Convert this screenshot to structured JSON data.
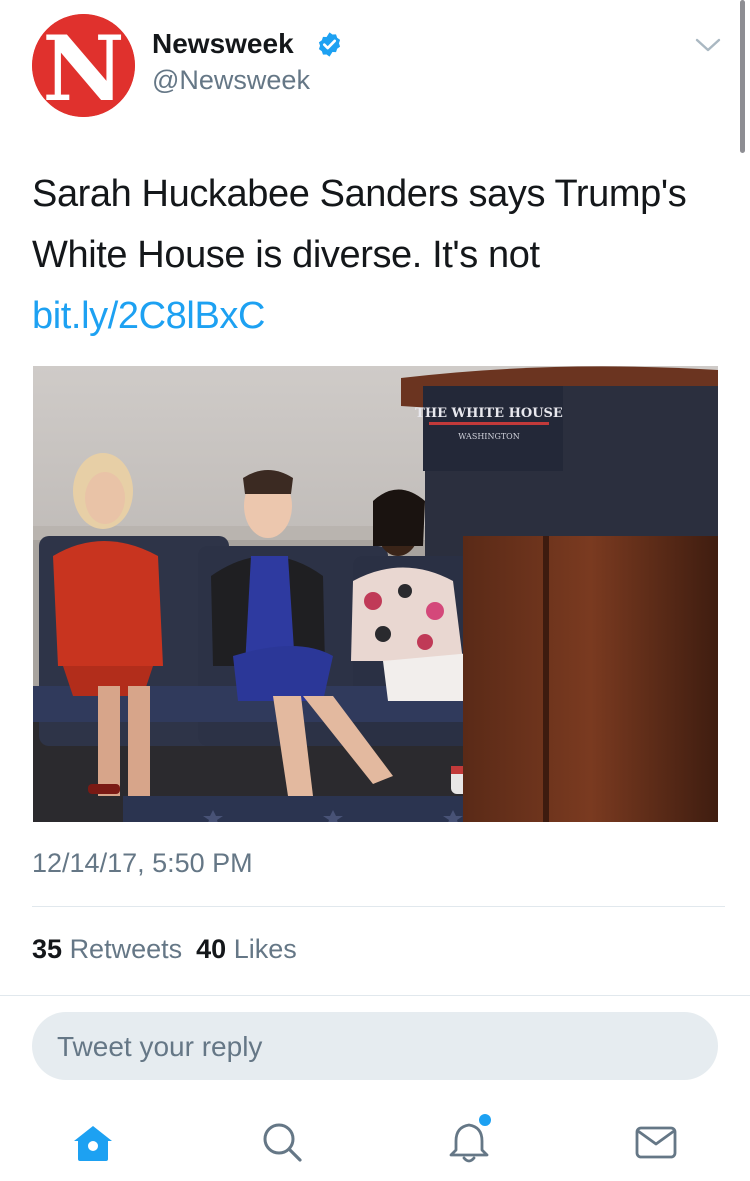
{
  "tweet": {
    "author": {
      "name": "Newsweek",
      "handle": "@Newsweek",
      "avatar_letter": "N",
      "verified": true
    },
    "text": "Sarah Huckabee Sanders says Trump's White House is diverse. It's not ",
    "link": "bit.ly/2C8lBxC",
    "media": {
      "podium_sign_line1": "THE WHITE HOUSE",
      "podium_sign_line2": "WASHINGTON"
    },
    "timestamp": "12/14/17, 5:50 PM",
    "stats": {
      "retweets_count": "35",
      "retweets_label": "Retweets",
      "likes_count": "40",
      "likes_label": "Likes"
    }
  },
  "reply": {
    "placeholder": "Tweet your reply"
  },
  "tab_bar": {
    "items": [
      {
        "icon": "home-icon",
        "active": true
      },
      {
        "icon": "search-icon",
        "active": false
      },
      {
        "icon": "notifications-icon",
        "active": false,
        "badge": true
      },
      {
        "icon": "messages-icon",
        "active": false
      }
    ]
  },
  "colors": {
    "accent": "#1da1f2",
    "text": "#14171a",
    "secondary_text": "#657786",
    "brand_red": "#e0312d"
  }
}
